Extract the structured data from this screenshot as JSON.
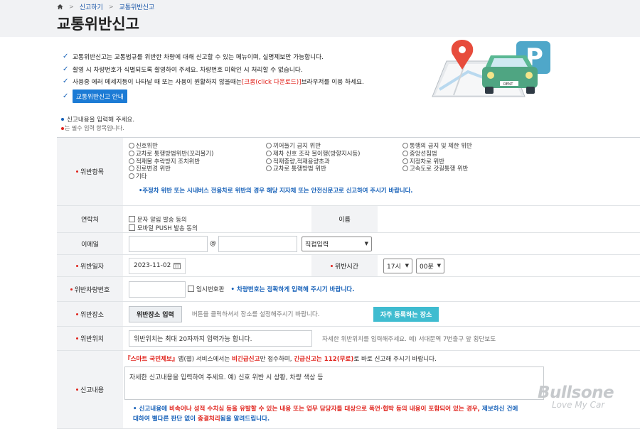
{
  "breadcrumb": {
    "items": [
      "신고하기",
      "교통위반신고"
    ]
  },
  "page": {
    "title": "교통위반신고"
  },
  "notice": {
    "line1": "교통위반신고는 교통법규를 위반한 차량에 대해 신고할 수 있는 메뉴이며, 실명제보만 가능합니다.",
    "line2": "촬영 시 차량번호가 식별되도록 촬영하여 주세요. 차량번호 미확인 시 처리할 수 없습니다.",
    "line3_before": "사용중 에러 메세지등이 나타날 때 또는 사용이 원활하지 않을때는 ",
    "line3_link": "[크롬(click 다운로드)]",
    "line3_after": "브라우저를 이용 하세요.",
    "guide_button": "교통위반신고 안내"
  },
  "required_note": {
    "main": "신고내용을 입력해 주세요.",
    "sub": "는 필수 입력 항목입니다."
  },
  "violations": {
    "label": "위반항목",
    "col1": [
      "신호위반",
      "교차로 통행방법위반(꼬리물기)",
      "적재물 추락방지 조치위반",
      "진로변경 위반",
      "기타"
    ],
    "col2": [
      "끼어들기 금지 위반",
      "제차 신호 조작 불이행(방향지시등)",
      "적재중량,적재용량초과",
      "교차로 통행방법 위반"
    ],
    "col3": [
      "통행의 금지 및 제한 위반",
      "중앙선침범",
      "지정차로 위반",
      "고속도로 갓길통행 위반"
    ],
    "note": "•주정차 위반 또는 시내버스 전용차로 위반의 경우 해당 지자체 또는 안전신문고로 신고하여 주시기 바랍니다."
  },
  "contact": {
    "label": "연락처",
    "sms": "문자 알림 발송 동의",
    "push": "모바일 PUSH 발송 동의",
    "name_label": "이름"
  },
  "email": {
    "label": "이메일",
    "at": "@",
    "domain_select": "직접입력"
  },
  "date": {
    "label": "위반일자",
    "value": "2023-11-02",
    "time_label": "위반시간",
    "hour": "17시",
    "minute": "00분"
  },
  "plate": {
    "label": "위반차량번호",
    "temp": "임시번호판",
    "help": "• 차량번호는 정확하게 입력해 주시기 바랍니다."
  },
  "place": {
    "label": "위반장소",
    "button": "위반장소 입력",
    "help": "버튼을 클릭하셔서 장소를 설정해주시기 바랍니다.",
    "fav_button": "자주 등록하는 장소"
  },
  "location": {
    "label": "위반위치",
    "placeholder": "위반위치는 최대 20자까지 입력가능 합니다.",
    "help": "자세한 위반위치를 입력해주세요. 예) 서대문역 7번출구 앞 횡단보도"
  },
  "report": {
    "label": "신고내용",
    "app_name": "『스마트 국민제보』",
    "intro_mid": "앱(웹) 서비스에서는 ",
    "emergency": "비긴급신고",
    "intro_mid2": "만 접수하며, ",
    "urgent": "긴급신고는 112(무료)",
    "intro_end": "로 바로 신고해 주시기 바랍니다.",
    "placeholder": "자세한 신고내용을 입력하여 주세요. 예) 신호 위반 시 상황, 차량 색상 등",
    "note_a": "• 신고내용에 ",
    "note_b": "비속어나 성적 수치심 등을 유발할 수 있는 내용 또는 업무 담당자를 대상으로 폭언·협박 등의 내용이 포함되어 있는 경우,",
    "note_c": " 제보하신 건에",
    "note_d": "대하여 별다른 판단 없이 ",
    "note_e": "종결처리",
    "note_f": "됨을 알려드립니다."
  },
  "watermark": {
    "brand": "Bullsone",
    "slogan": "Love My Car"
  },
  "colors": {
    "accent": "#1c7bd5",
    "link_blue": "#1560b8",
    "required_red": "#e0231c",
    "teal_button": "#3fbcd0"
  }
}
